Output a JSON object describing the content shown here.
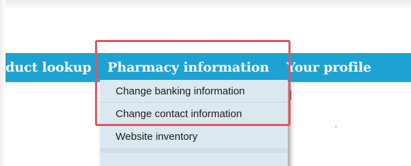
{
  "nav": {
    "items": [
      {
        "label": "duct lookup"
      },
      {
        "label": "Pharmacy information"
      },
      {
        "label": "Your profile"
      }
    ]
  },
  "dropdown": {
    "items": [
      {
        "label": "Change banking information"
      },
      {
        "label": "Change contact information"
      },
      {
        "label": "Website inventory"
      }
    ]
  },
  "colors": {
    "navbar": "#1ea2d3",
    "dropdown_bg": "#dce8ef",
    "highlight": "#e05560"
  }
}
